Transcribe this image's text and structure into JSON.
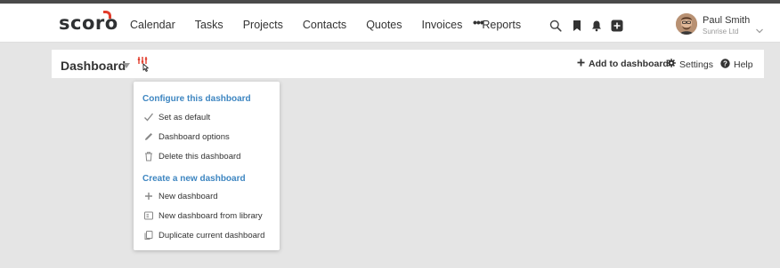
{
  "app": {
    "logo_text": "scoro",
    "brand_color": "#e23c2b"
  },
  "topnav": {
    "items": [
      {
        "label": "Calendar"
      },
      {
        "label": "Tasks"
      },
      {
        "label": "Projects"
      },
      {
        "label": "Contacts"
      },
      {
        "label": "Quotes"
      },
      {
        "label": "Invoices"
      },
      {
        "label": "Reports"
      }
    ],
    "more_label": "•••",
    "icons": [
      "search-icon",
      "bookmark-icon",
      "bell-icon",
      "add-icon"
    ]
  },
  "user": {
    "name": "Paul Smith",
    "company": "Sunrise Ltd"
  },
  "dashboard_bar": {
    "title": "Dashboard",
    "add_label": "Add to dashboard",
    "settings_label": "Settings",
    "help_label": "Help"
  },
  "dropdown": {
    "heading_color": "#3e86c1",
    "section1_heading": "Configure this dashboard",
    "section1_items": [
      {
        "label": "Set as default",
        "icon": "checkmark-icon"
      },
      {
        "label": "Dashboard options",
        "icon": "pencil-icon"
      },
      {
        "label": "Delete this dashboard",
        "icon": "trash-icon"
      }
    ],
    "section2_heading": "Create a new dashboard",
    "section2_items": [
      {
        "label": "New dashboard",
        "icon": "plus-icon"
      },
      {
        "label": "New dashboard from library",
        "icon": "library-icon"
      },
      {
        "label": "Duplicate current dashboard",
        "icon": "duplicate-icon"
      }
    ]
  }
}
